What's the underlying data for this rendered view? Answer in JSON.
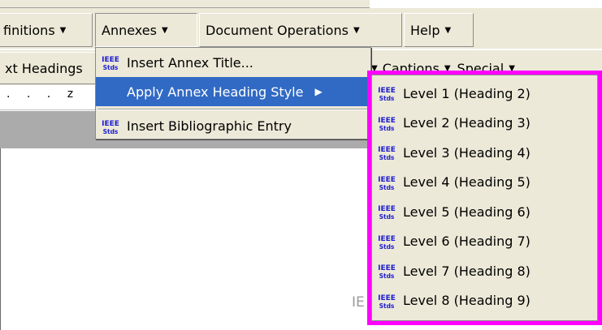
{
  "menubar": {
    "items": [
      {
        "label": "finitions",
        "arrow": "▼"
      },
      {
        "label": "Annexes",
        "arrow": "▼"
      },
      {
        "label": "Document Operations",
        "arrow": "▼"
      },
      {
        "label": "Help",
        "arrow": "▼"
      }
    ]
  },
  "toolbar": {
    "left_label": "xt Headings",
    "captions_label": "Captions",
    "special_label": "Special",
    "arrow": "▼"
  },
  "ruler": {
    "marks": ". . . z"
  },
  "annex_menu": {
    "items": [
      {
        "label": "Insert Annex Title...",
        "icon": "ieee-stds-icon"
      },
      {
        "label": "Apply Annex Heading Style",
        "submenu_arrow": "▶"
      },
      {
        "label": "Insert Bibliographic Entry",
        "icon": "ieee-stds-icon"
      }
    ]
  },
  "submenu": {
    "items": [
      {
        "label": "Level 1 (Heading 2)"
      },
      {
        "label": "Level 2 (Heading 3)"
      },
      {
        "label": "Level 3 (Heading 4)"
      },
      {
        "label": "Level 4 (Heading 5)"
      },
      {
        "label": "Level 5 (Heading 6)"
      },
      {
        "label": "Level 6 (Heading 7)"
      },
      {
        "label": "Level 7 (Heading 8)"
      },
      {
        "label": "Level 8 (Heading 9)"
      }
    ]
  },
  "doc_text": "IE",
  "icon": {
    "top": "IEEE",
    "bottom": "Stds"
  },
  "colors": {
    "highlight": "#316ac5",
    "annotation_border": "#ff00ff",
    "icon_blue": "#1d1dd0",
    "chrome": "#ece9d8"
  }
}
